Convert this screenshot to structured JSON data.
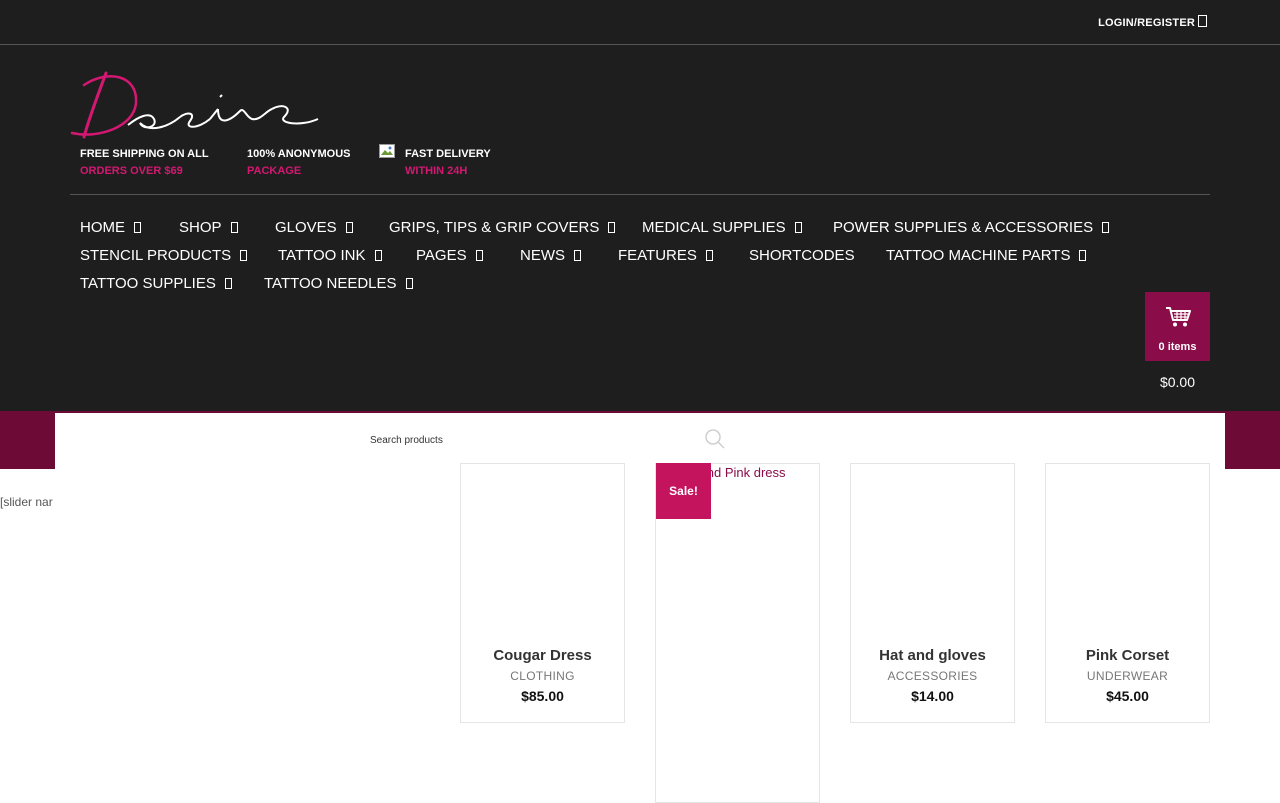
{
  "topbar": {
    "login_label": "LOGIN/REGISTER",
    "login_icon": "user-icon"
  },
  "header": {
    "logo_text": "Desire",
    "features": [
      {
        "line1": "FREE SHIPPING ON ALL",
        "line2": "ORDERS OVER $69"
      },
      {
        "line1": "100% ANONYMOUS",
        "line2": "PACKAGE"
      },
      {
        "line1": "FAST DELIVERY",
        "line2": "WITHIN 24H"
      }
    ]
  },
  "nav": {
    "items": [
      {
        "label": "HOME"
      },
      {
        "label": "SHOP"
      },
      {
        "label": "GLOVES"
      },
      {
        "label": "GRIPS, TIPS & GRIP COVERS"
      },
      {
        "label": "MEDICAL SUPPLIES"
      },
      {
        "label": "POWER SUPPLIES & ACCESSORIES"
      },
      {
        "label": "STENCIL PRODUCTS"
      },
      {
        "label": "TATTOO INK"
      },
      {
        "label": "PAGES"
      },
      {
        "label": "NEWS"
      },
      {
        "label": "FEATURES"
      },
      {
        "label": "SHORTCODES"
      },
      {
        "label": "TATTOO MACHINE PARTS"
      },
      {
        "label": "TATTOO SUPPLIES"
      },
      {
        "label": "TATTOO NEEDLES"
      }
    ]
  },
  "cart": {
    "count": "0 items",
    "total": "$0.00",
    "icon": "shopping-cart-icon"
  },
  "search": {
    "placeholder": "Search products",
    "icon": "search-icon"
  },
  "slider_text": "[slider nar",
  "products": [
    {
      "name": "Cougar Dress",
      "category": "CLOTHING",
      "price": "$85.00"
    },
    {
      "name": "Black and Pink dress",
      "visible_title": "k and Pink dress",
      "sale_badge": "Sale!"
    },
    {
      "name": "Hat and gloves",
      "category": "ACCESSORIES",
      "price": "$14.00"
    },
    {
      "name": "Pink Corset",
      "category": "UNDERWEAR",
      "price": "$45.00"
    }
  ],
  "colors": {
    "accent": "#d41872",
    "brand_dark": "#8a0c48",
    "band": "#6d0a36",
    "header_bg": "#1e1e1e"
  }
}
